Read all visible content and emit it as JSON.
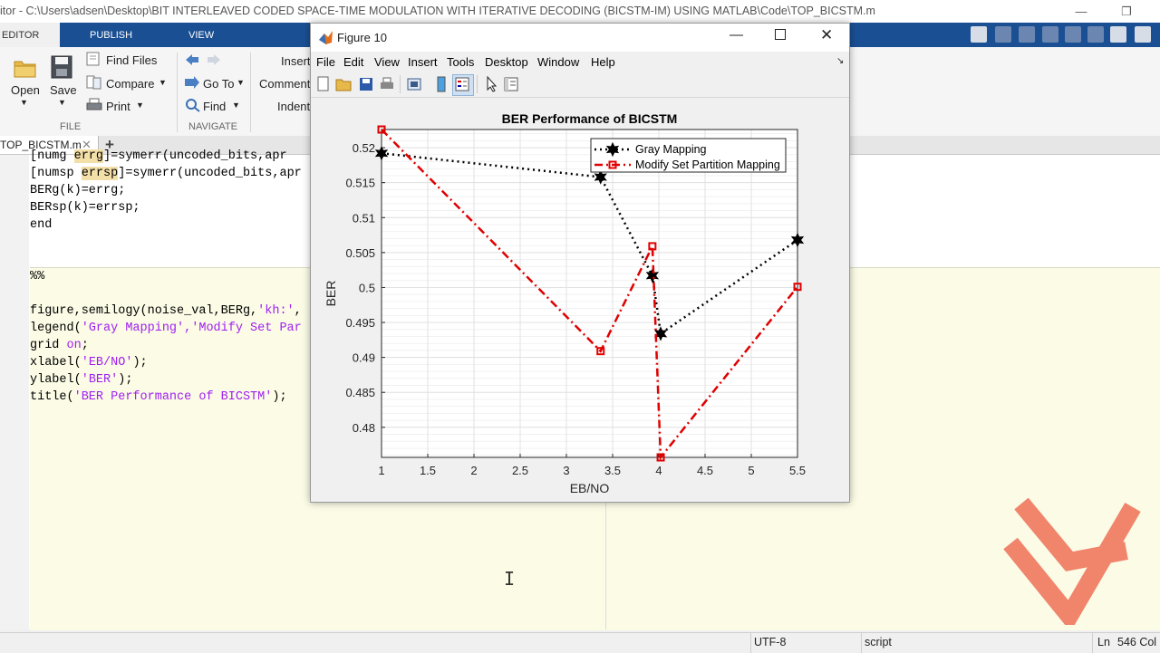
{
  "window": {
    "title": "itor - C:\\Users\\adsen\\Desktop\\BIT INTERLEAVED CODED SPACE-TIME MODULATION WITH ITERATIVE DECODING (BICSTM-IM) USING MATLAB\\Code\\TOP_BICSTM.m"
  },
  "ribbon": {
    "tabs": [
      "EDITOR",
      "PUBLISH",
      "VIEW"
    ],
    "file": {
      "open": "Open",
      "save": "Save",
      "find_files": "Find Files",
      "compare": "Compare",
      "print": "Print",
      "section": "FILE"
    },
    "navigate": {
      "go_to": "Go To",
      "find": "Find",
      "section": "NAVIGATE"
    },
    "edit": {
      "insert": "Insert",
      "comment": "Comment",
      "indent": "Indent"
    }
  },
  "editor": {
    "file_tab": "TOP_BICSTM.m",
    "add_tab": "+",
    "lines": [
      {
        "pre": "[numg ",
        "hl": "errg",
        "post": "]=symerr(uncoded_bits,apr"
      },
      {
        "pre": "[numsp ",
        "hl": "errsp",
        "post": "]=symerr(uncoded_bits,apr"
      },
      {
        "text": "BERg(k)=errg;"
      },
      {
        "text": "BERsp(k)=errsp;"
      },
      {
        "keyword": "end"
      },
      {
        "comment": "%%"
      },
      {
        "pre": "figure,semilogy(noise_val,BERg,",
        "str": "'kh:'",
        "post": ","
      },
      {
        "pre": "legend(",
        "str": "'Gray Mapping','Modify Set Par",
        "post": ""
      },
      {
        "pre": "grid ",
        "kw2": "on",
        "post": ";"
      },
      {
        "pre": "xlabel(",
        "str": "'EB/NO'",
        "post": ");"
      },
      {
        "pre": "ylabel(",
        "str": "'BER'",
        "post": ");"
      },
      {
        "pre": "title(",
        "str": "'BER Performance of BICSTM'",
        "post": ");"
      }
    ]
  },
  "status": {
    "encoding": "UTF-8",
    "type": "script",
    "ln_label": "Ln",
    "col_label": "546 Col"
  },
  "figure": {
    "title": "Figure 10",
    "menu": [
      "File",
      "Edit",
      "View",
      "Insert",
      "Tools",
      "Desktop",
      "Window",
      "Help"
    ],
    "toolbar_icons": [
      "new-figure-icon",
      "open-file-icon",
      "save-figure-icon",
      "print-figure-icon",
      "link-plot-icon",
      "insert-colorbar-icon",
      "insert-legend-icon",
      "edit-plot-icon",
      "property-inspector-icon"
    ]
  },
  "chart_data": {
    "type": "line",
    "title": "BER Performance of BICSTM",
    "xlabel": "EB/NO",
    "ylabel": "BER",
    "xlim": [
      1,
      5.5
    ],
    "ylim": [
      0.4757,
      0.5226
    ],
    "xticks": [
      "1",
      "1.5",
      "2",
      "2.5",
      "3",
      "3.5",
      "4",
      "4.5",
      "5",
      "5.5"
    ],
    "yticks": [
      "0.48",
      "0.485",
      "0.49",
      "0.495",
      "0.5",
      "0.505",
      "0.51",
      "0.515",
      "0.52"
    ],
    "grid": true,
    "legend_position": "top-right",
    "series": [
      {
        "name": "Gray Mapping",
        "color": "#000000",
        "line": "dotted",
        "marker": "hexagram",
        "x": [
          1,
          3.37,
          3.93,
          4.02,
          5.5
        ],
        "y": [
          0.5192,
          0.5158,
          0.5017,
          0.4934,
          0.5068
        ]
      },
      {
        "name": "Modify Set Partition Mapping",
        "color": "#e00000",
        "line": "dashdot",
        "marker": "square",
        "x": [
          1,
          3.37,
          3.93,
          4.02,
          5.5
        ],
        "y": [
          0.5226,
          0.4909,
          0.5059,
          0.4757,
          0.5001
        ]
      }
    ]
  }
}
